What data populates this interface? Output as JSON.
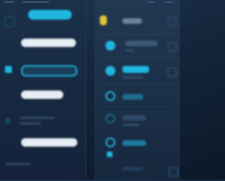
{
  "colors": {
    "accent_cyan": "#1fb6e0",
    "accent_yellow": "#e0c23a",
    "pill_white": "#e6edf3",
    "muted": "#3b5472",
    "background": "#14263c"
  },
  "left_list": {
    "items": [
      {
        "icon": "square-icon",
        "label": "",
        "style": "cyan-pill"
      },
      {
        "icon": "",
        "label": "",
        "style": "white-pill"
      },
      {
        "icon": "square-icon",
        "label": "",
        "style": "cyan-outline"
      },
      {
        "icon": "",
        "label": "",
        "style": "white-pill"
      },
      {
        "icon": "square-icon",
        "label": "",
        "style": "muted"
      },
      {
        "icon": "",
        "label": "",
        "style": "white-pill"
      },
      {
        "icon": "",
        "label": "",
        "style": "muted"
      }
    ]
  },
  "right_list": {
    "items": [
      {
        "icon": "lightbulb-icon",
        "label": ""
      },
      {
        "icon": "wifi-icon",
        "label": ""
      },
      {
        "icon": "circle-icon",
        "label": ""
      },
      {
        "icon": "shield-icon",
        "label": ""
      },
      {
        "icon": "wifi-icon",
        "label": ""
      },
      {
        "icon": "wifi-icon",
        "label": ""
      },
      {
        "icon": "square-icon",
        "label": ""
      }
    ]
  }
}
